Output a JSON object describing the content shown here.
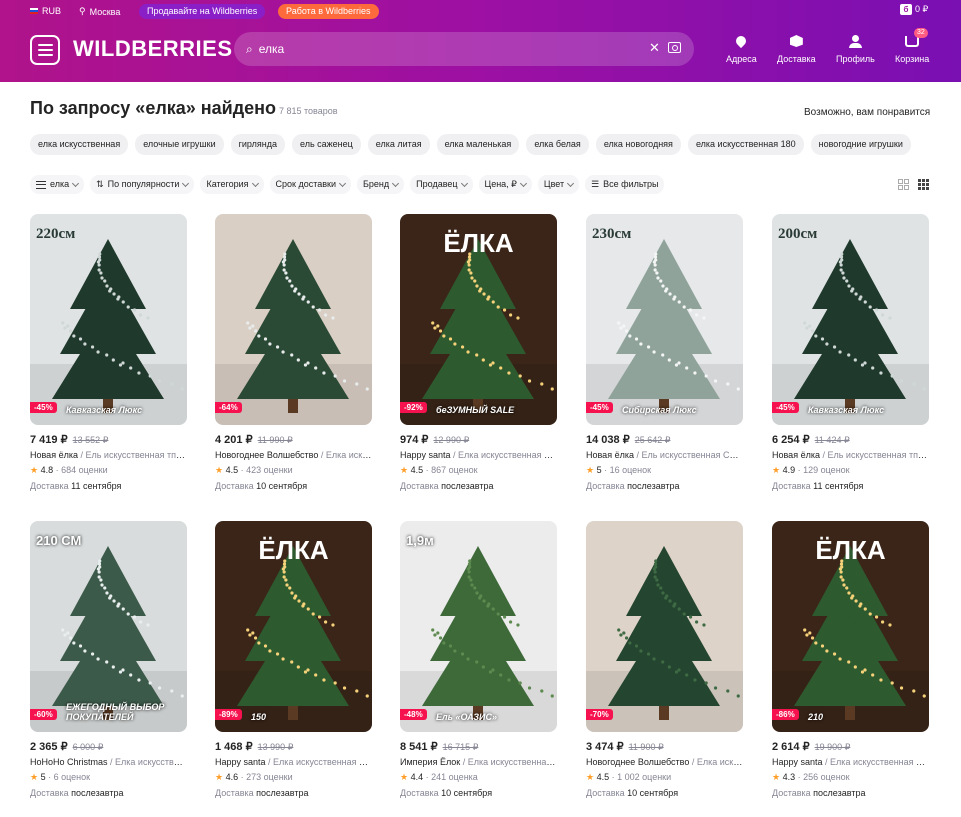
{
  "topbar": {
    "currency": "RUB",
    "city": "Москва",
    "sell": "Продавайте на Wildberries",
    "work": "Работа в Wildberries",
    "wallet": "0 ₽"
  },
  "header": {
    "logo": "WILDBERRIES",
    "search_value": "елка",
    "cart_count": "32",
    "nav": [
      {
        "label": "Адреса",
        "icon": "location-pin-icon"
      },
      {
        "label": "Доставка",
        "icon": "delivery-box-icon"
      },
      {
        "label": "Профиль",
        "icon": "profile-icon"
      },
      {
        "label": "Корзина",
        "icon": "cart-icon"
      }
    ]
  },
  "results": {
    "title": "По запросу «елка» найдено",
    "count": "7 815 товаров",
    "maybe": "Возможно, вам понравится"
  },
  "chips": [
    "елка искусственная",
    "елочные игрушки",
    "гирлянда",
    "ель саженец",
    "елка литая",
    "елка маленькая",
    "елка белая",
    "елка новогодняя",
    "елка искусственная 180",
    "новогодние игрушки"
  ],
  "filters": [
    "елка",
    "По популярности",
    "Категория",
    "Срок доставки",
    "Бренд",
    "Продавец",
    "Цена, ₽",
    "Цвет",
    "Все фильтры"
  ],
  "products": [
    {
      "price": "7 419 ₽",
      "old": "13 552 ₽",
      "brand": "Новая ёлка",
      "cat": " / Ель искусственная тпк \"...",
      "rating": "4.8",
      "reviews": "684 оценки",
      "deliv_label": "Доставка",
      "deliv": "11 сентября",
      "discount": "-45%",
      "img_text": "220см",
      "caption": "Кавказская Люкс",
      "bg": "#dfe3e4",
      "tree": "#1f3a2c",
      "snow": "#cfd8d6"
    },
    {
      "price": "4 201 ₽",
      "old": "11 990 ₽",
      "brand": "Новогоднее Волшебство",
      "cat": " / Елка искус...",
      "rating": "4.5",
      "reviews": "423 оценки",
      "deliv_label": "Доставка",
      "deliv": "10 сентября",
      "discount": "-64%",
      "img_text": "",
      "caption": "",
      "bg": "#d9cfc5",
      "tree": "#2b4a36",
      "snow": "#e8ecec"
    },
    {
      "price": "974 ₽",
      "old": "12 990 ₽",
      "brand": "Happy santa",
      "cat": " / Елка искусственная 120...",
      "rating": "4.5",
      "reviews": "867 оценок",
      "deliv_label": "Доставка",
      "deliv": "послезавтра",
      "discount": "-92%",
      "img_text": "ЁЛКА",
      "caption": "беЗУМНЫЙ SALE",
      "bg": "#3a2518",
      "tree": "#2d5a2e",
      "snow": "#f5d27a"
    },
    {
      "price": "14 038 ₽",
      "old": "25 642 ₽",
      "brand": "Новая ёлка",
      "cat": " / Ель искусственная Сиби...",
      "rating": "5",
      "reviews": "16 оценок",
      "deliv_label": "Доставка",
      "deliv": "послезавтра",
      "discount": "-45%",
      "img_text": "230см",
      "caption": "Сибирская Люкс",
      "bg": "#e6e8ea",
      "tree": "#8fa39a",
      "snow": "#f4f6f6"
    },
    {
      "price": "6 254 ₽",
      "old": "11 424 ₽",
      "brand": "Новая ёлка",
      "cat": " / Ель искусственная тпк \"...",
      "rating": "4.9",
      "reviews": "129 оценок",
      "deliv_label": "Доставка",
      "deliv": "11 сентября",
      "discount": "-45%",
      "img_text": "200см",
      "caption": "Кавказская Люкс",
      "bg": "#dfe3e4",
      "tree": "#1f3a2c",
      "snow": "#cfd8d6"
    },
    {
      "price": "2 365 ₽",
      "old": "6 000 ₽",
      "brand": "HoHoHo Christmas",
      "cat": " / Елка искусственн...",
      "rating": "5",
      "reviews": "6 оценок",
      "deliv_label": "Доставка",
      "deliv": "послезавтра",
      "discount": "-60%",
      "img_text": "210 СМ",
      "caption": "ЕЖЕГОДНЫЙ ВЫБОР ПОКУПАТЕЛЕЙ",
      "bg": "#d8dcdc",
      "tree": "#3c5a4a",
      "snow": "#e9eeee"
    },
    {
      "price": "1 468 ₽",
      "old": "13 990 ₽",
      "brand": "Happy santa",
      "cat": " / Елка искусственная 150...",
      "rating": "4.6",
      "reviews": "273 оценки",
      "deliv_label": "Доставка",
      "deliv": "послезавтра",
      "discount": "-89%",
      "img_text": "ЁЛКА",
      "caption": "150",
      "bg": "#3a2518",
      "tree": "#2d5a2e",
      "snow": "#f5d27a"
    },
    {
      "price": "8 541 ₽",
      "old": "16 715 ₽",
      "brand": "Империя Ёлок",
      "cat": " / Елка искусственная н...",
      "rating": "4.4",
      "reviews": "241 оценка",
      "deliv_label": "Доставка",
      "deliv": "10 сентября",
      "discount": "-48%",
      "img_text": "1,9м",
      "caption": "Ель «ОАЗИС»",
      "bg": "#ececec",
      "tree": "#3e6a3a",
      "snow": "#5d8a4f"
    },
    {
      "price": "3 474 ₽",
      "old": "11 900 ₽",
      "brand": "Новогоднее Волшебство",
      "cat": " / Елка искус...",
      "rating": "4.5",
      "reviews": "1 002 оценки",
      "deliv_label": "Доставка",
      "deliv": "10 сентября",
      "discount": "-70%",
      "img_text": "",
      "caption": "",
      "bg": "#ddd3c9",
      "tree": "#24452f",
      "snow": "#3e6b44"
    },
    {
      "price": "2 614 ₽",
      "old": "19 900 ₽",
      "brand": "Happy santa",
      "cat": " / Елка искусственная 210...",
      "rating": "4.3",
      "reviews": "256 оценок",
      "deliv_label": "Доставка",
      "deliv": "послезавтра",
      "discount": "-86%",
      "img_text": "ЁЛКА",
      "caption": "210",
      "bg": "#3a2518",
      "tree": "#2d5a2e",
      "snow": "#f5d27a"
    }
  ]
}
